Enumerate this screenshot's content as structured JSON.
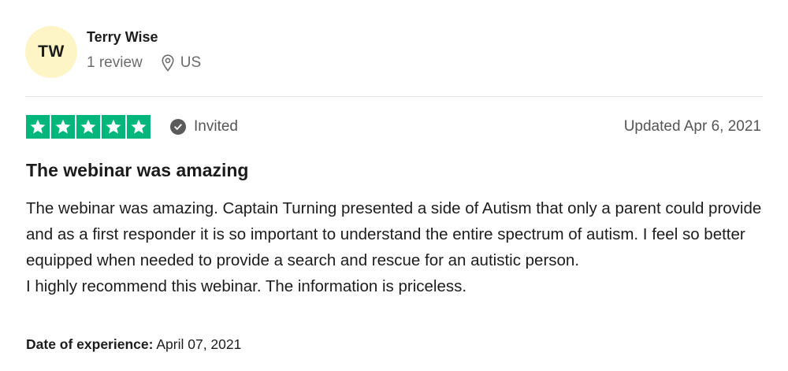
{
  "reviewer": {
    "initials": "TW",
    "name": "Terry Wise",
    "review_count": "1 review",
    "country": "US"
  },
  "rating": {
    "stars": 5,
    "max_stars": 5,
    "star_color": "#00b67a",
    "avatar_color": "#fdf5c6",
    "badge_label": "Invited",
    "updated_label": "Updated Apr 6, 2021"
  },
  "review": {
    "title": "The webinar was amazing",
    "paragraphs": [
      "The webinar was amazing. Captain Turning presented a side of Autism that only a parent could provide and as a first responder it is so important to understand the entire spectrum of autism. I feel so better equipped when needed to provide a search and rescue for an autistic person.",
      "I highly recommend this webinar. The information is priceless."
    ]
  },
  "experience": {
    "label": "Date of experience:",
    "date": "April 07, 2021"
  }
}
